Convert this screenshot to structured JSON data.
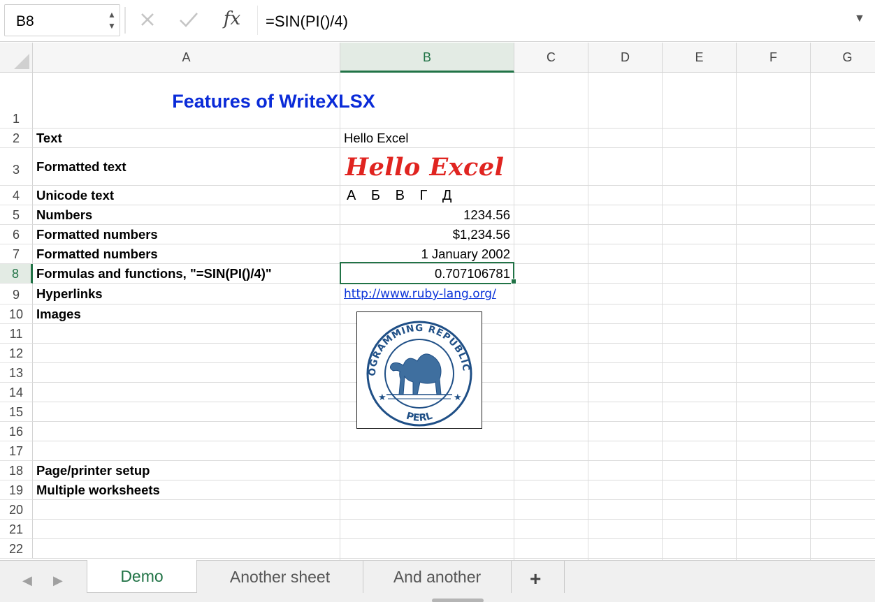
{
  "formula_bar": {
    "name_box": "B8",
    "formula": "=SIN(PI()/4)",
    "cancel_icon": "close-icon",
    "confirm_icon": "check-icon",
    "fx_label": "fx"
  },
  "columns": [
    "A",
    "B",
    "C",
    "D",
    "E",
    "F",
    "G"
  ],
  "selected_column": "B",
  "rows": [
    "1",
    "2",
    "3",
    "4",
    "5",
    "6",
    "7",
    "8",
    "9",
    "10",
    "11",
    "12",
    "13",
    "14",
    "15",
    "16",
    "17",
    "18",
    "19",
    "20",
    "21",
    "22"
  ],
  "selected_row": "8",
  "cells": {
    "A1": "Features of WriteXLSX",
    "A2": "Text",
    "B2": "Hello Excel",
    "A3": "Formatted text",
    "B3": "Hello Excel",
    "A4": "Unicode text",
    "B4": "А Б В Г Д",
    "A5": "Numbers",
    "B5": "1234.56",
    "A6": "Formatted numbers",
    "B6": "$1,234.56",
    "A7": "Formatted numbers",
    "B7": "1 January 2002",
    "A8": "Formulas and functions, \"=SIN(PI()/4)\"",
    "B8": "0.707106781",
    "A9": "Hyperlinks",
    "B9": "http://www.ruby-lang.org/",
    "A10": "Images",
    "A18": "Page/printer setup",
    "A19": "Multiple worksheets"
  },
  "image": {
    "seal_top": "PROGRAMMING REPUBLIC OF",
    "seal_bottom": "PERL",
    "color": "#1f4f86"
  },
  "sheet_tabs": {
    "tabs": [
      "Demo",
      "Another sheet",
      "And another"
    ],
    "active": "Demo",
    "add_label": "+"
  },
  "colors": {
    "accent": "#217346",
    "title": "#0a2bd8",
    "fancy_text": "#e02420",
    "link": "#0b34d9"
  }
}
